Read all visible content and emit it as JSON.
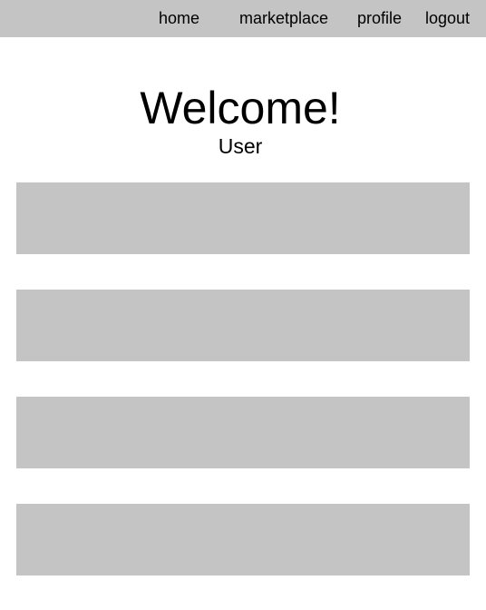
{
  "colors": {
    "navbar_bg": "#c4c4c4",
    "card_bg": "#c4c4c4",
    "page_bg": "#ffffff",
    "text": "#000000"
  },
  "nav": {
    "home": "home",
    "marketplace": "marketplace",
    "profile": "profile",
    "logout": "logout"
  },
  "hero": {
    "title": "Welcome!",
    "subtitle": "User"
  },
  "cards": [
    "",
    "",
    "",
    ""
  ]
}
